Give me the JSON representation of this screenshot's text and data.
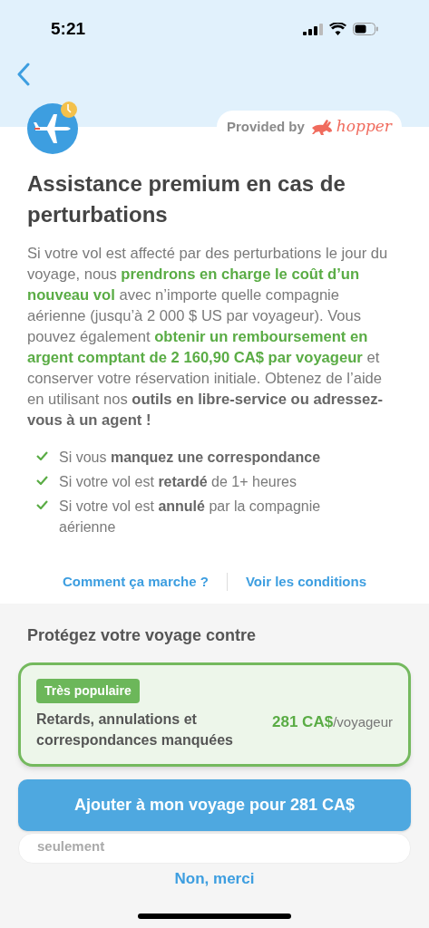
{
  "status_bar": {
    "time": "5:21"
  },
  "provider": {
    "label": "Provided by",
    "brand": "hopper"
  },
  "title": "Assistance premium en cas de perturbations",
  "description": [
    {
      "text": "Si votre vol est affecté par des perturbations le jour du voyage, nous ",
      "kind": "plain"
    },
    {
      "text": "prendrons en charge le coût d’un nouveau vol",
      "kind": "highlight"
    },
    {
      "text": " avec n’importe quelle compagnie aérienne (jusqu’à 2 000 $ US par voyageur). Vous pouvez également ",
      "kind": "plain"
    },
    {
      "text": "obtenir un remboursement en argent comptant de 2 160,90 CA$ par voyageur",
      "kind": "highlight"
    },
    {
      "text": " et conserver votre réservation initiale. Obtenez de l’aide en utilisant nos ",
      "kind": "plain"
    },
    {
      "text": "outils en libre-service ou adressez-vous à un agent !",
      "kind": "bold"
    }
  ],
  "coverage": [
    "Si vous **manquez une correspondance**",
    "Si votre vol est **retardé** de 1+ heures",
    "Si votre vol est **annulé** par la compagnie aérienne"
  ],
  "links": [
    "Comment ça marche ?",
    "Voir les conditions"
  ],
  "protect": {
    "heading": "Protégez votre voyage contre",
    "options": [
      {
        "badge": "Très populaire",
        "name": "Retards, annulations et correspondances manquées",
        "price": "281 CA$",
        "unit": "/voyageur",
        "selected": true
      },
      {
        "name": "seulement",
        "selected": false
      }
    ]
  },
  "add_button": "Ajouter à mon voyage pour 281 CA$",
  "decline": "Non, merci"
}
